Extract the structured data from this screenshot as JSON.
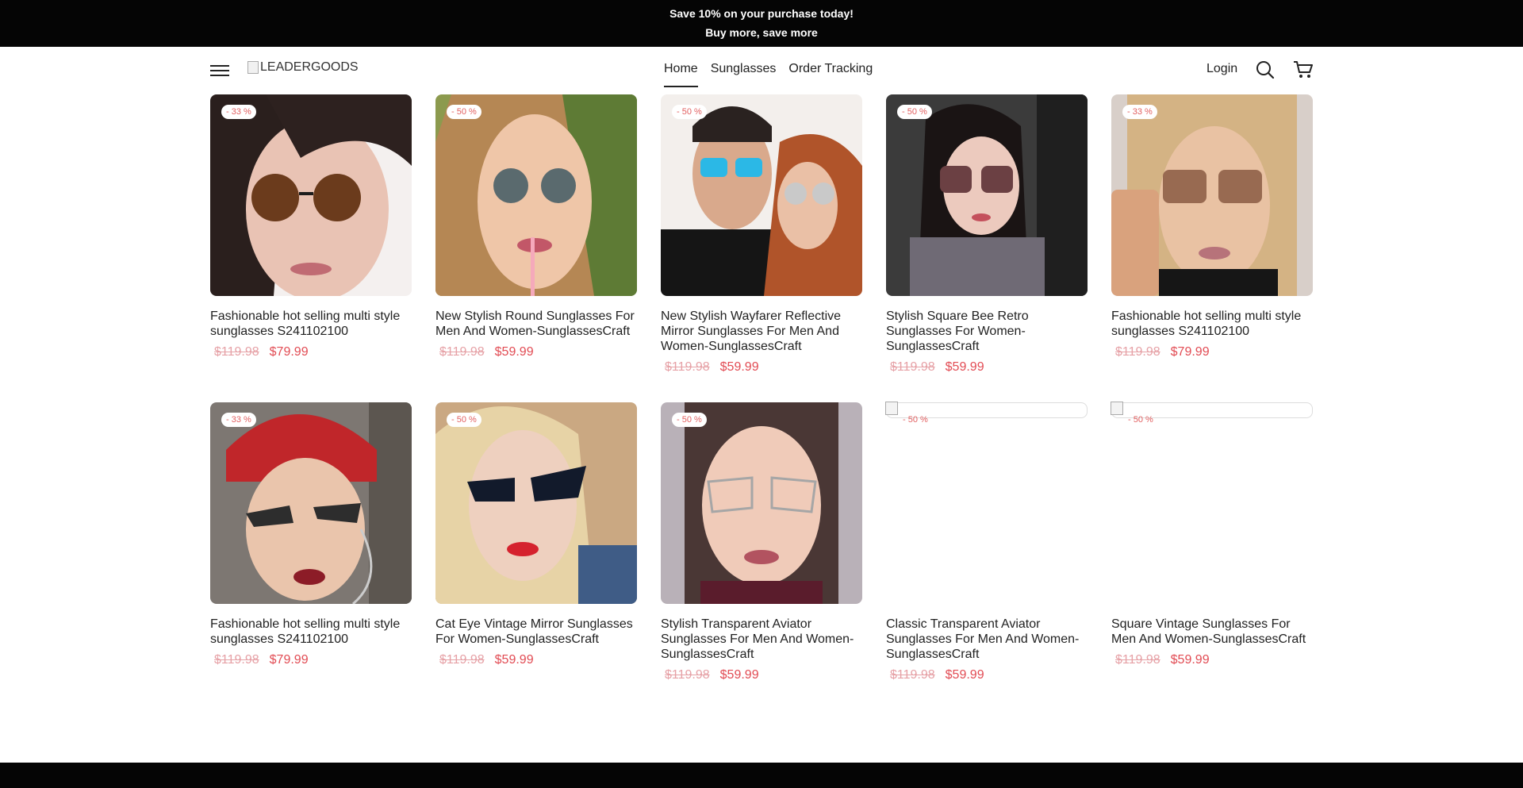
{
  "announcement": {
    "line1": "Save 10% on your purchase today!",
    "line2": "Buy more, save more"
  },
  "header": {
    "logo_text": "LEADERGOODS",
    "nav": [
      {
        "label": "Home",
        "active": true
      },
      {
        "label": "Sunglasses",
        "active": false
      },
      {
        "label": "Order Tracking",
        "active": false
      }
    ],
    "login_label": "Login"
  },
  "products": [
    {
      "badge": "- 33 %",
      "title": "Fashionable hot selling multi style sunglasses S241102100",
      "old_price": "$119.98",
      "price": "$79.99",
      "image": "woman-brown-round-sunglasses"
    },
    {
      "badge": "- 50 %",
      "title": "New Stylish Round Sunglasses For Men And Women-SunglassesCraft",
      "old_price": "$119.98",
      "price": "$59.99",
      "image": "woman-round-metal-sunglasses"
    },
    {
      "badge": "- 50 %",
      "title": "New Stylish Wayfarer Reflective Mirror Sunglasses For Men And Women-SunglassesCraft",
      "old_price": "$119.98",
      "price": "$59.99",
      "image": "couple-mirror-sunglasses"
    },
    {
      "badge": "- 50 %",
      "title": "Stylish Square Bee Retro Sunglasses For Women-SunglassesCraft",
      "old_price": "$119.98",
      "price": "$59.99",
      "image": "woman-square-sunglasses-car"
    },
    {
      "badge": "- 33 %",
      "title": "Fashionable hot selling multi style sunglasses S241102100",
      "old_price": "$119.98",
      "price": "$79.99",
      "image": "woman-gold-square-sunglasses"
    },
    {
      "badge": "- 33 %",
      "title": "Fashionable hot selling multi style sunglasses S241102100",
      "old_price": "$119.98",
      "price": "$79.99",
      "image": "woman-cat-eye-red-beanie"
    },
    {
      "badge": "- 50 %",
      "title": "Cat Eye Vintage Mirror Sunglasses For Women-SunglassesCraft",
      "old_price": "$119.98",
      "price": "$59.99",
      "image": "blonde-cat-eye-sunglasses"
    },
    {
      "badge": "- 50 %",
      "title": "Stylish Transparent Aviator Sunglasses For Men And Women-SunglassesCraft",
      "old_price": "$119.98",
      "price": "$59.99",
      "image": "woman-clear-aviator-glasses"
    },
    {
      "badge": "- 50 %",
      "title": "Classic Transparent Aviator Sunglasses For Men And Women-SunglassesCraft",
      "old_price": "$119.98",
      "price": "$59.99",
      "image": "broken-image"
    },
    {
      "badge": "- 50 %",
      "title": "Square Vintage Sunglasses For Men And Women-SunglassesCraft",
      "old_price": "$119.98",
      "price": "$59.99",
      "image": "broken-image"
    }
  ],
  "colors": {
    "announcement_bg": "#050505",
    "badge": "#e26061",
    "sale_price": "#e24c54",
    "old_price": "#e6a1a6"
  }
}
